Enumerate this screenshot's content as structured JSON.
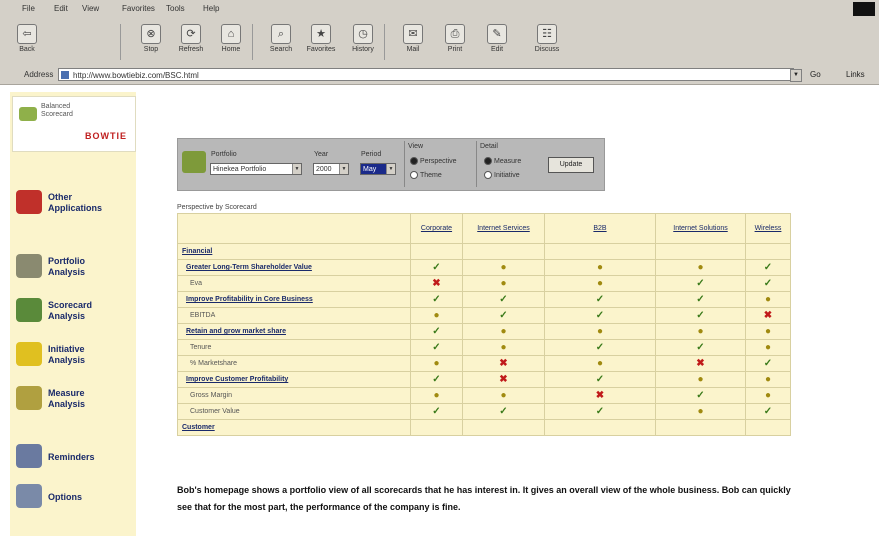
{
  "menu": [
    "File",
    "Edit",
    "View",
    "Favorites",
    "Tools",
    "Help"
  ],
  "toolbar": [
    {
      "label": "Back",
      "icon": "back-arrow-icon",
      "glyph": "⇦"
    },
    {
      "label": "Stop",
      "icon": "stop-icon",
      "glyph": "⊗"
    },
    {
      "label": "Refresh",
      "icon": "refresh-icon",
      "glyph": "⟳"
    },
    {
      "label": "Home",
      "icon": "home-icon",
      "glyph": "⌂"
    },
    {
      "label": "Search",
      "icon": "search-icon",
      "glyph": "⌕"
    },
    {
      "label": "Favorites",
      "icon": "favorites-icon",
      "glyph": "★"
    },
    {
      "label": "History",
      "icon": "history-icon",
      "glyph": "◷"
    },
    {
      "label": "Mail",
      "icon": "mail-icon",
      "glyph": "✉"
    },
    {
      "label": "Print",
      "icon": "print-icon",
      "glyph": "⎙"
    },
    {
      "label": "Edit",
      "icon": "edit-icon",
      "glyph": "✎"
    },
    {
      "label": "Discuss",
      "icon": "discuss-icon",
      "glyph": "☷"
    }
  ],
  "address": {
    "label": "Address",
    "url": "http://www.bowtiebiz.com/BSC.html",
    "go": "Go",
    "links": "Links"
  },
  "logo": {
    "line1": "Balanced",
    "line2": "Scorecard",
    "brand": "BOWTIE"
  },
  "nav": [
    {
      "l1": "Other",
      "l2": "Applications",
      "icon": "applications-icon",
      "color": "#c0302a"
    },
    {
      "l1": "Portfolio",
      "l2": "Analysis",
      "icon": "folder-icon",
      "color": "#8a8a70"
    },
    {
      "l1": "Scorecard",
      "l2": "Analysis",
      "icon": "scorecard-icon",
      "color": "#5a8a3a"
    },
    {
      "l1": "Initiative",
      "l2": "Analysis",
      "icon": "lightbulb-icon",
      "color": "#e0c020"
    },
    {
      "l1": "Measure",
      "l2": "Analysis",
      "icon": "scale-icon",
      "color": "#b0a040"
    },
    {
      "l1": "Reminders",
      "l2": "",
      "icon": "reminders-icon",
      "color": "#6a7aa0"
    },
    {
      "l1": "Options",
      "l2": "",
      "icon": "options-icon",
      "color": "#7a8aa8"
    }
  ],
  "filter": {
    "portfolio_label": "Portfolio",
    "portfolio_value": "Hinekea Portfolio",
    "year_label": "Year",
    "year_value": "2000",
    "period_label": "Period",
    "period_value": "May",
    "view_label": "View",
    "view_opt1": "Perspective",
    "view_opt2": "Theme",
    "detail_label": "Detail",
    "detail_opt1": "Measure",
    "detail_opt2": "Initiative",
    "update": "Update"
  },
  "perspective_label": "Perspective by Scorecard",
  "columns": [
    "Corporate",
    "Internet Services",
    "B2B",
    "Internet Solutions",
    "Wireless"
  ],
  "rows": [
    {
      "name": "Financial",
      "kind": "sec",
      "cells": [
        "",
        "",
        "",
        "",
        ""
      ]
    },
    {
      "name": "Greater Long-Term Shareholder Value",
      "kind": "obj",
      "cells": [
        "g",
        "y",
        "y",
        "y",
        "g"
      ]
    },
    {
      "name": "Eva",
      "kind": "meas",
      "cells": [
        "r",
        "y",
        "y",
        "g",
        "g"
      ]
    },
    {
      "name": "Improve Profitability in Core Business",
      "kind": "obj",
      "cells": [
        "g",
        "g",
        "g",
        "g",
        "y"
      ]
    },
    {
      "name": "EBITDA",
      "kind": "meas",
      "cells": [
        "y",
        "g",
        "g",
        "g",
        "r"
      ]
    },
    {
      "name": "Retain and grow market share",
      "kind": "obj",
      "cells": [
        "g",
        "y",
        "y",
        "y",
        "y"
      ]
    },
    {
      "name": "Tenure",
      "kind": "meas",
      "cells": [
        "g",
        "y",
        "g",
        "g",
        "y"
      ]
    },
    {
      "name": "% Marketshare",
      "kind": "meas",
      "cells": [
        "y",
        "r",
        "y",
        "r",
        "g"
      ]
    },
    {
      "name": "Improve Customer Profitability",
      "kind": "obj",
      "cells": [
        "g",
        "r",
        "g",
        "y",
        "y"
      ]
    },
    {
      "name": "Gross Margin",
      "kind": "meas",
      "cells": [
        "y",
        "y",
        "r",
        "g",
        "y"
      ]
    },
    {
      "name": "Customer Value",
      "kind": "meas",
      "cells": [
        "g",
        "g",
        "g",
        "y",
        "g"
      ]
    },
    {
      "name": "Customer",
      "kind": "sec",
      "cells": [
        "",
        "",
        "",
        "",
        ""
      ]
    }
  ],
  "caption": "Bob's homepage shows a portfolio view of all scorecards that he has interest in. It gives an overall view of the whole business. Bob can quickly see that for the most part, the performance of the company is fine.",
  "colors": {
    "sidebar": "#fbf4cc",
    "link": "#1a2a6a",
    "good": "#3a7a1a",
    "caution": "#a08a10",
    "bad": "#c01a1a"
  }
}
